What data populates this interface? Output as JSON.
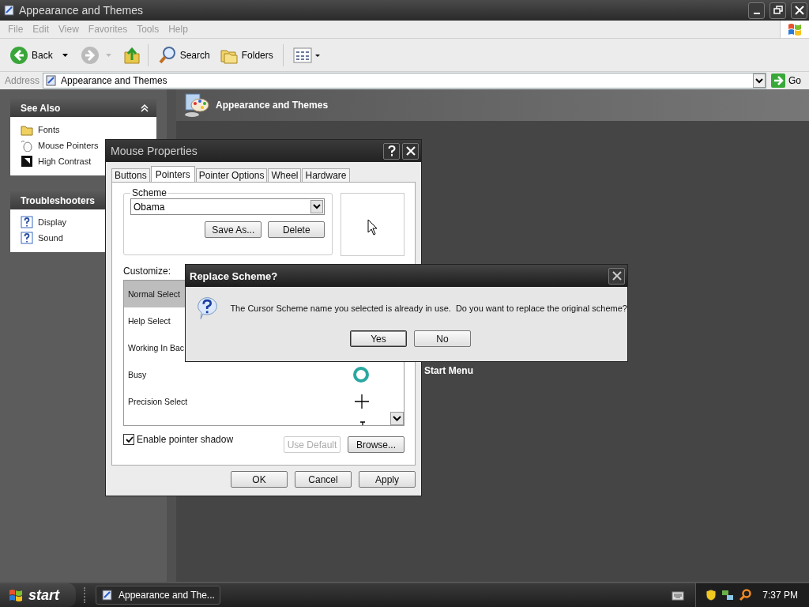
{
  "explorer": {
    "title": "Appearance and Themes",
    "menu": [
      "File",
      "Edit",
      "View",
      "Favorites",
      "Tools",
      "Help"
    ],
    "toolbar": {
      "back": "Back",
      "search": "Search",
      "folders": "Folders"
    },
    "address": {
      "label": "Address",
      "value": "Appearance and Themes",
      "go": "Go"
    },
    "sidebar": [
      {
        "title": "See Also",
        "items": [
          "Fonts",
          "Mouse Pointers",
          "High Contrast"
        ]
      },
      {
        "title": "Troubleshooters",
        "items": [
          "Display",
          "Sound"
        ]
      }
    ],
    "header": "Appearance and Themes",
    "link": "Start Menu"
  },
  "mouse_properties": {
    "title": "Mouse Properties",
    "tabs": [
      {
        "label": "Buttons",
        "selected": false
      },
      {
        "label": "Pointers",
        "selected": true
      },
      {
        "label": "Pointer Options",
        "selected": false
      },
      {
        "label": "Wheel",
        "selected": false
      },
      {
        "label": "Hardware",
        "selected": false
      }
    ],
    "scheme": {
      "label": "Scheme",
      "value": "Obama",
      "buttons": [
        "Save As...",
        "Delete"
      ]
    },
    "customize_label": "Customize:",
    "rows": [
      {
        "label": "Normal Select",
        "selected": true
      },
      {
        "label": "Help Select",
        "selected": false
      },
      {
        "label": "Working In Bac",
        "selected": false
      },
      {
        "label": "Busy",
        "selected": false,
        "kind": "busy"
      },
      {
        "label": "Precision Select",
        "selected": false,
        "kind": "cross"
      },
      {
        "selected": false,
        "kind": "ibeam"
      }
    ],
    "shadow": {
      "label": "Enable pointer shadow",
      "checked": true
    },
    "use_default": {
      "label": "Use Default",
      "disabled": true
    },
    "browse": "Browse...",
    "buttons": [
      "OK",
      "Cancel",
      "Apply"
    ]
  },
  "dialog": {
    "title": "Replace Scheme?",
    "message": "The Cursor Scheme name you selected is already in use.  Do you want to replace the original scheme?",
    "buttons": [
      "Yes",
      "No"
    ]
  },
  "taskbar": {
    "start": "start",
    "tasks": [
      {
        "label": "Appearance and The...",
        "selected": false
      }
    ],
    "time": "7:37 PM"
  }
}
